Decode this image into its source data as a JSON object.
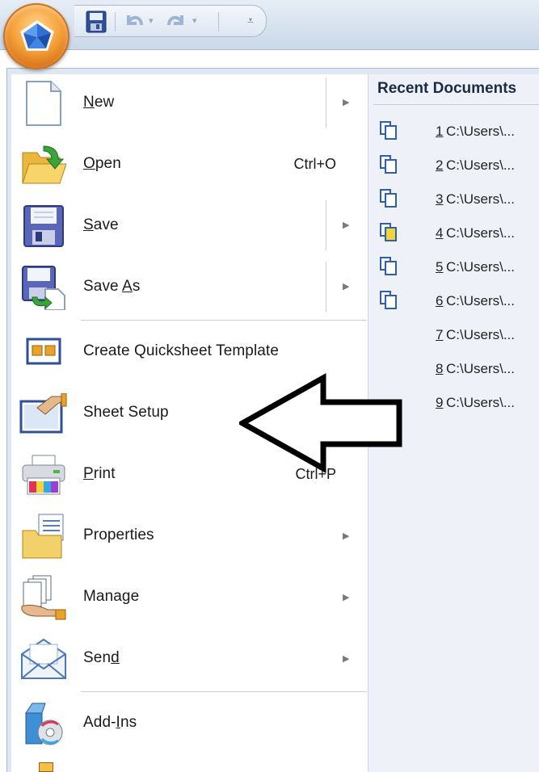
{
  "menu": {
    "items": [
      {
        "label": "New",
        "underline": "N",
        "rest": "ew",
        "shortcut": "",
        "submenu": true,
        "icon": "new-document-icon"
      },
      {
        "label": "Open",
        "underline": "O",
        "rest": "pen",
        "shortcut": "Ctrl+O",
        "submenu": false,
        "icon": "open-folder-icon"
      },
      {
        "label": "Save",
        "underline": "S",
        "rest": "ave",
        "shortcut": "",
        "submenu": true,
        "icon": "save-disk-icon"
      },
      {
        "label": "Save As",
        "before": "Save ",
        "underline": "A",
        "rest": "s",
        "shortcut": "",
        "submenu": true,
        "icon": "save-as-icon"
      },
      {
        "label": "Create Quicksheet Template",
        "shortcut": "",
        "submenu": false,
        "icon": "quicksheet-template-icon"
      },
      {
        "label": "Sheet Setup",
        "shortcut": "",
        "submenu": false,
        "icon": "sheet-setup-icon"
      },
      {
        "label": "Print",
        "underline": "P",
        "rest": "rint",
        "shortcut": "Ctrl+P",
        "submenu": false,
        "icon": "printer-icon"
      },
      {
        "label": "Properties",
        "shortcut": "",
        "submenu": true,
        "icon": "properties-folder-icon"
      },
      {
        "label": "Manage",
        "shortcut": "",
        "submenu": true,
        "icon": "manage-documents-icon"
      },
      {
        "label": "Send",
        "before": "Sen",
        "underline": "d",
        "rest": "",
        "shortcut": "",
        "submenu": true,
        "icon": "send-envelope-icon"
      },
      {
        "label": "Add-Ins",
        "before": "Add-",
        "underline": "I",
        "rest": "ns",
        "shortcut": "",
        "submenu": false,
        "icon": "add-ins-icon"
      }
    ]
  },
  "recent": {
    "title": "Recent Documents",
    "items": [
      {
        "num": "1",
        "path": "C:\\Users\\...",
        "icon": "linked-document-icon"
      },
      {
        "num": "2",
        "path": "C:\\Users\\...",
        "icon": "linked-document-icon"
      },
      {
        "num": "3",
        "path": "C:\\Users\\...",
        "icon": "linked-document-icon"
      },
      {
        "num": "4",
        "path": "C:\\Users\\...",
        "icon": "linked-document-yellow-icon"
      },
      {
        "num": "5",
        "path": "C:\\Users\\...",
        "icon": "linked-document-icon"
      },
      {
        "num": "6",
        "path": "C:\\Users\\...",
        "icon": "linked-document-icon"
      },
      {
        "num": "7",
        "path": "C:\\Users\\..."
      },
      {
        "num": "8",
        "path": "C:\\Users\\..."
      },
      {
        "num": "9",
        "path": "C:\\Users\\..."
      }
    ]
  },
  "quick_access": {
    "buttons": [
      "save-icon",
      "undo-icon",
      "redo-icon",
      "customize-dropdown-icon"
    ]
  },
  "colors": {
    "orb": "#f6a33c",
    "menu_bg": "#dfe7f1",
    "recent_bg": "#eef2f8",
    "title_text": "#1b2b44"
  }
}
